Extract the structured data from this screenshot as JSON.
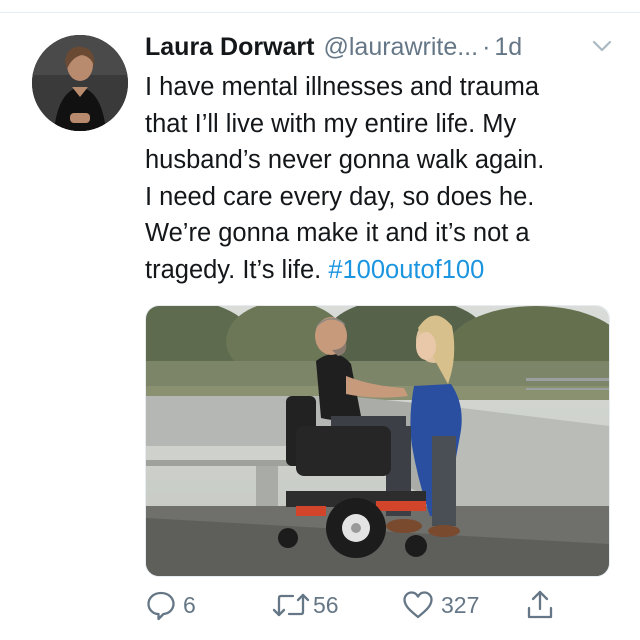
{
  "tweet": {
    "author_name": "Laura Dorwart",
    "handle": "@laurawrite...",
    "separator": "·",
    "time": "1d",
    "text": "I have mental illnesses and trauma\nthat I’ll live with my entire life. My\nhusband’s never gonna walk again.\nI need care every day, so does he.\nWe’re gonna make it and it’s not a\ntragedy. It’s life.  ",
    "hashtag": "#100outof100",
    "media_alt": "Man in a wheelchair with his hand on his pregnant wife's belly outdoors"
  },
  "actions": {
    "reply_count": "6",
    "retweet_count": "56",
    "like_count": "327"
  },
  "icons": {
    "reply": "reply-icon",
    "retweet": "retweet-icon",
    "like": "like-icon",
    "share": "share-icon",
    "caret": "chevron-down-icon"
  },
  "colors": {
    "hashtag": "#1b95e0",
    "secondary_text": "#657786",
    "primary_text": "#14171a"
  }
}
